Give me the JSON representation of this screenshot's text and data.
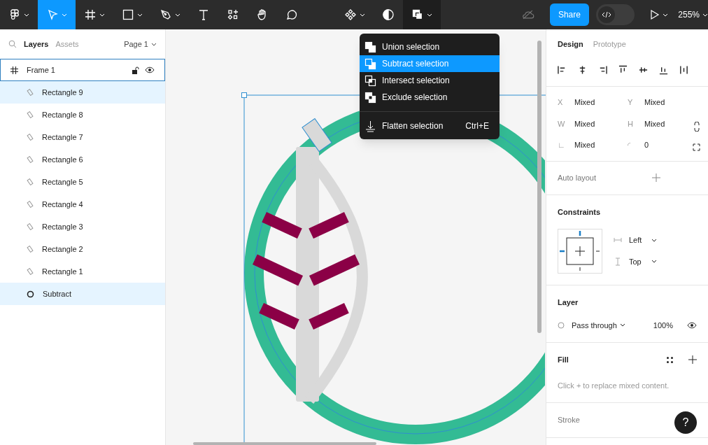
{
  "toolbar": {
    "tools": [
      {
        "kind": "logo",
        "selected": false,
        "caret": true
      },
      {
        "kind": "move",
        "selected": true,
        "caret": true
      },
      {
        "kind": "frame",
        "selected": false,
        "caret": true
      },
      {
        "kind": "rectangle",
        "selected": false,
        "caret": true
      },
      {
        "kind": "pen",
        "selected": false,
        "caret": true
      },
      {
        "kind": "text",
        "selected": false,
        "caret": false
      },
      {
        "kind": "resources",
        "selected": false,
        "caret": false
      },
      {
        "kind": "hand",
        "selected": false,
        "caret": false
      },
      {
        "kind": "comment",
        "selected": false,
        "caret": false
      }
    ],
    "center_tools": [
      {
        "kind": "component",
        "selected": false,
        "caret": true
      },
      {
        "kind": "mask",
        "selected": false,
        "caret": false
      },
      {
        "kind": "boolean",
        "selected": true,
        "caret": true
      }
    ],
    "share": "Share",
    "dev_mode": {
      "on": false
    },
    "zoom": "255%"
  },
  "boolean_menu": {
    "items": [
      {
        "kind": "union",
        "label": "Union selection",
        "selected": false
      },
      {
        "kind": "subtract",
        "label": "Subtract selection",
        "selected": true
      },
      {
        "kind": "intersect",
        "label": "Intersect selection",
        "selected": false
      },
      {
        "kind": "exclude",
        "label": "Exclude selection",
        "selected": false
      }
    ],
    "flatten": {
      "label": "Flatten selection",
      "shortcut": "Ctrl+E"
    }
  },
  "left_panel": {
    "tabs": [
      {
        "label": "Layers",
        "selected": true
      },
      {
        "label": "Assets",
        "selected": false
      }
    ],
    "page": "Page 1",
    "frame": {
      "name": "Frame 1",
      "selected": false
    },
    "layers": [
      {
        "name": "Rectangle 9",
        "kind": "rectangle",
        "selected": true
      },
      {
        "name": "Rectangle 8",
        "kind": "rectangle",
        "selected": false
      },
      {
        "name": "Rectangle 7",
        "kind": "rectangle",
        "selected": false
      },
      {
        "name": "Rectangle 6",
        "kind": "rectangle",
        "selected": false
      },
      {
        "name": "Rectangle 5",
        "kind": "rectangle",
        "selected": false
      },
      {
        "name": "Rectangle 4",
        "kind": "rectangle",
        "selected": false
      },
      {
        "name": "Rectangle 3",
        "kind": "rectangle",
        "selected": false
      },
      {
        "name": "Rectangle 2",
        "kind": "rectangle",
        "selected": false
      },
      {
        "name": "Rectangle 1",
        "kind": "rectangle",
        "selected": false
      },
      {
        "name": "Subtract",
        "kind": "boolean",
        "selected": true
      }
    ]
  },
  "right_panel": {
    "tabs": [
      {
        "label": "Design",
        "selected": true
      },
      {
        "label": "Prototype",
        "selected": false
      }
    ],
    "fields": [
      {
        "label": "X",
        "value": "Mixed"
      },
      {
        "label": "Y",
        "value": "Mixed"
      },
      {
        "label": "W",
        "value": "Mixed"
      },
      {
        "label": "H",
        "value": "Mixed"
      },
      {
        "label": "∟",
        "value": "Mixed"
      },
      {
        "label": "◜",
        "value": "0"
      }
    ],
    "auto_layout": "Auto layout",
    "constraints": {
      "title": "Constraints",
      "horizontal": "Left",
      "vertical": "Top"
    },
    "layer": {
      "title": "Layer",
      "blend": "Pass through",
      "opacity": "100%"
    },
    "fill": {
      "title": "Fill",
      "hint": "Click + to replace mixed content."
    },
    "stroke": {
      "title": "Stroke"
    },
    "help": "?"
  }
}
